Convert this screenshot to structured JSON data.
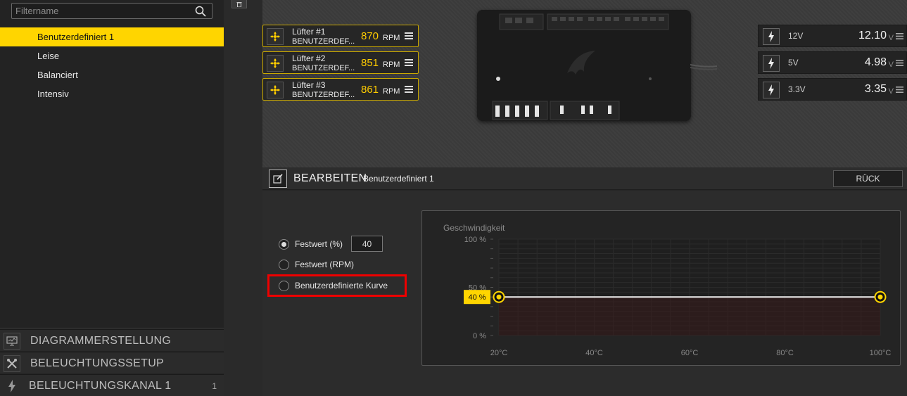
{
  "sidebar": {
    "filter_placeholder": "Filtername",
    "profiles": [
      {
        "label": "Benutzerdefiniert 1",
        "active": true
      },
      {
        "label": "Leise",
        "active": false
      },
      {
        "label": "Balanciert",
        "active": false
      },
      {
        "label": "Intensiv",
        "active": false
      }
    ],
    "sections": [
      {
        "label": "DIAGRAMMERSTELLUNG",
        "icon": "monitor-icon",
        "count": ""
      },
      {
        "label": "BELEUCHTUNGSSETUP",
        "icon": "tools-icon",
        "count": ""
      },
      {
        "label": "BELEUCHTUNGSKANAL 1",
        "icon": "lightning-icon",
        "count": "1"
      }
    ]
  },
  "fans": [
    {
      "name": "Lüfter #1",
      "profile": "BENUTZERDEF...",
      "rpm": "870",
      "unit": "RPM"
    },
    {
      "name": "Lüfter #2",
      "profile": "BENUTZERDEF...",
      "rpm": "851",
      "unit": "RPM"
    },
    {
      "name": "Lüfter #3",
      "profile": "BENUTZERDEF...",
      "rpm": "861",
      "unit": "RPM"
    }
  ],
  "voltages": [
    {
      "label": "12V",
      "value": "12.10",
      "unit": "V"
    },
    {
      "label": "5V",
      "value": "4.98",
      "unit": "V"
    },
    {
      "label": "3.3V",
      "value": "3.35",
      "unit": "V"
    }
  ],
  "edit": {
    "title": "BEARBEITEN",
    "profile_name": "Benutzerdefiniert 1",
    "back_label": "RÜCK"
  },
  "modes": [
    {
      "label": "Festwert (%)",
      "checked": true
    },
    {
      "label": "Festwert (RPM)",
      "checked": false
    },
    {
      "label": "Benutzerdefinierte Kurve",
      "checked": false
    }
  ],
  "fixed_value": "40",
  "chart_data": {
    "type": "line",
    "title": "Geschwindigkeit",
    "y_ticks": [
      "100 %",
      "50 %",
      "0 %"
    ],
    "x_ticks": [
      "20°C",
      "40°C",
      "60°C",
      "80°C",
      "100°C"
    ],
    "xlim": [
      20,
      100
    ],
    "ylim": [
      0,
      100
    ],
    "series": [
      {
        "x": [
          20,
          100
        ],
        "y": [
          40,
          40
        ]
      }
    ],
    "current_label": "40 %",
    "accent": "#ffd500"
  }
}
